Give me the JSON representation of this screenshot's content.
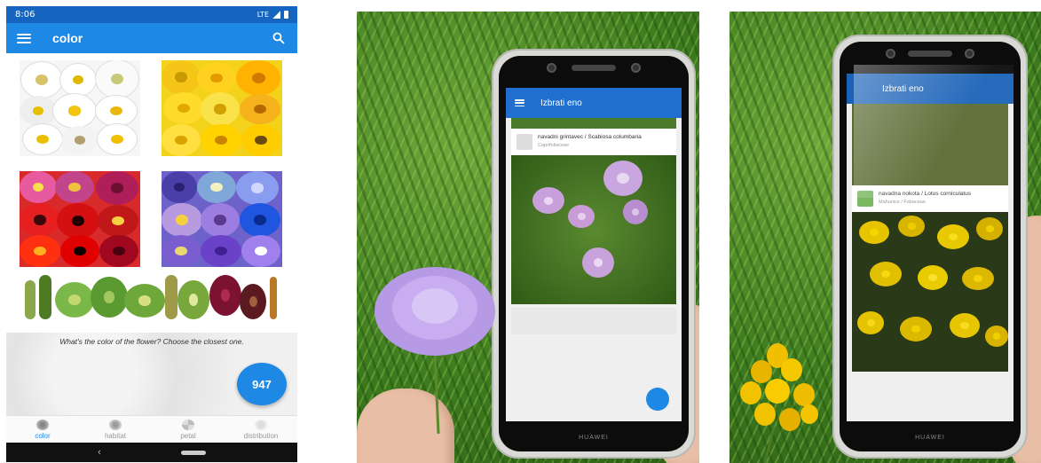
{
  "app": {
    "status_bar": {
      "time": "8:06",
      "network": "LTE"
    },
    "title": "color",
    "hint": "What's the color of the flower? Choose the closest one.",
    "count": "947",
    "bottom_nav": [
      {
        "label": "color",
        "active": true
      },
      {
        "label": "habitat",
        "active": false
      },
      {
        "label": "petal",
        "active": false
      },
      {
        "label": "distribution",
        "active": false
      }
    ],
    "tiles": [
      {
        "name": "white"
      },
      {
        "name": "yellow"
      },
      {
        "name": "red"
      },
      {
        "name": "blue-violet"
      },
      {
        "name": "green-brown"
      }
    ]
  },
  "photo1": {
    "screen_title": "Izbrati eno",
    "species": "navadni grintavec / Scabiosa columbaria",
    "family": "Caprifoliaceae",
    "brand": "HUAWEI"
  },
  "photo2": {
    "screen_title": "Izbrati eno",
    "species": "navadna nokota / Lotus corniculatus",
    "family": "Mahunice / Fabaceae",
    "brand": "HUAWEI"
  },
  "colors": {
    "app_bar": "#1e88e5",
    "status_bar": "#1565c0",
    "accent": "#1e88e5"
  }
}
